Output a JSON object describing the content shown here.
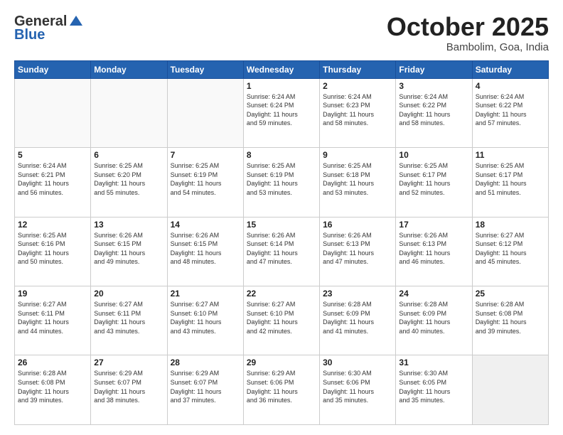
{
  "header": {
    "logo_general": "General",
    "logo_blue": "Blue",
    "month_title": "October 2025",
    "subtitle": "Bambolim, Goa, India"
  },
  "days_of_week": [
    "Sunday",
    "Monday",
    "Tuesday",
    "Wednesday",
    "Thursday",
    "Friday",
    "Saturday"
  ],
  "weeks": [
    [
      {
        "day": "",
        "info": ""
      },
      {
        "day": "",
        "info": ""
      },
      {
        "day": "",
        "info": ""
      },
      {
        "day": "1",
        "info": "Sunrise: 6:24 AM\nSunset: 6:24 PM\nDaylight: 11 hours\nand 59 minutes."
      },
      {
        "day": "2",
        "info": "Sunrise: 6:24 AM\nSunset: 6:23 PM\nDaylight: 11 hours\nand 58 minutes."
      },
      {
        "day": "3",
        "info": "Sunrise: 6:24 AM\nSunset: 6:22 PM\nDaylight: 11 hours\nand 58 minutes."
      },
      {
        "day": "4",
        "info": "Sunrise: 6:24 AM\nSunset: 6:22 PM\nDaylight: 11 hours\nand 57 minutes."
      }
    ],
    [
      {
        "day": "5",
        "info": "Sunrise: 6:24 AM\nSunset: 6:21 PM\nDaylight: 11 hours\nand 56 minutes."
      },
      {
        "day": "6",
        "info": "Sunrise: 6:25 AM\nSunset: 6:20 PM\nDaylight: 11 hours\nand 55 minutes."
      },
      {
        "day": "7",
        "info": "Sunrise: 6:25 AM\nSunset: 6:19 PM\nDaylight: 11 hours\nand 54 minutes."
      },
      {
        "day": "8",
        "info": "Sunrise: 6:25 AM\nSunset: 6:19 PM\nDaylight: 11 hours\nand 53 minutes."
      },
      {
        "day": "9",
        "info": "Sunrise: 6:25 AM\nSunset: 6:18 PM\nDaylight: 11 hours\nand 53 minutes."
      },
      {
        "day": "10",
        "info": "Sunrise: 6:25 AM\nSunset: 6:17 PM\nDaylight: 11 hours\nand 52 minutes."
      },
      {
        "day": "11",
        "info": "Sunrise: 6:25 AM\nSunset: 6:17 PM\nDaylight: 11 hours\nand 51 minutes."
      }
    ],
    [
      {
        "day": "12",
        "info": "Sunrise: 6:25 AM\nSunset: 6:16 PM\nDaylight: 11 hours\nand 50 minutes."
      },
      {
        "day": "13",
        "info": "Sunrise: 6:26 AM\nSunset: 6:15 PM\nDaylight: 11 hours\nand 49 minutes."
      },
      {
        "day": "14",
        "info": "Sunrise: 6:26 AM\nSunset: 6:15 PM\nDaylight: 11 hours\nand 48 minutes."
      },
      {
        "day": "15",
        "info": "Sunrise: 6:26 AM\nSunset: 6:14 PM\nDaylight: 11 hours\nand 47 minutes."
      },
      {
        "day": "16",
        "info": "Sunrise: 6:26 AM\nSunset: 6:13 PM\nDaylight: 11 hours\nand 47 minutes."
      },
      {
        "day": "17",
        "info": "Sunrise: 6:26 AM\nSunset: 6:13 PM\nDaylight: 11 hours\nand 46 minutes."
      },
      {
        "day": "18",
        "info": "Sunrise: 6:27 AM\nSunset: 6:12 PM\nDaylight: 11 hours\nand 45 minutes."
      }
    ],
    [
      {
        "day": "19",
        "info": "Sunrise: 6:27 AM\nSunset: 6:11 PM\nDaylight: 11 hours\nand 44 minutes."
      },
      {
        "day": "20",
        "info": "Sunrise: 6:27 AM\nSunset: 6:11 PM\nDaylight: 11 hours\nand 43 minutes."
      },
      {
        "day": "21",
        "info": "Sunrise: 6:27 AM\nSunset: 6:10 PM\nDaylight: 11 hours\nand 43 minutes."
      },
      {
        "day": "22",
        "info": "Sunrise: 6:27 AM\nSunset: 6:10 PM\nDaylight: 11 hours\nand 42 minutes."
      },
      {
        "day": "23",
        "info": "Sunrise: 6:28 AM\nSunset: 6:09 PM\nDaylight: 11 hours\nand 41 minutes."
      },
      {
        "day": "24",
        "info": "Sunrise: 6:28 AM\nSunset: 6:09 PM\nDaylight: 11 hours\nand 40 minutes."
      },
      {
        "day": "25",
        "info": "Sunrise: 6:28 AM\nSunset: 6:08 PM\nDaylight: 11 hours\nand 39 minutes."
      }
    ],
    [
      {
        "day": "26",
        "info": "Sunrise: 6:28 AM\nSunset: 6:08 PM\nDaylight: 11 hours\nand 39 minutes."
      },
      {
        "day": "27",
        "info": "Sunrise: 6:29 AM\nSunset: 6:07 PM\nDaylight: 11 hours\nand 38 minutes."
      },
      {
        "day": "28",
        "info": "Sunrise: 6:29 AM\nSunset: 6:07 PM\nDaylight: 11 hours\nand 37 minutes."
      },
      {
        "day": "29",
        "info": "Sunrise: 6:29 AM\nSunset: 6:06 PM\nDaylight: 11 hours\nand 36 minutes."
      },
      {
        "day": "30",
        "info": "Sunrise: 6:30 AM\nSunset: 6:06 PM\nDaylight: 11 hours\nand 35 minutes."
      },
      {
        "day": "31",
        "info": "Sunrise: 6:30 AM\nSunset: 6:05 PM\nDaylight: 11 hours\nand 35 minutes."
      },
      {
        "day": "",
        "info": ""
      }
    ]
  ]
}
